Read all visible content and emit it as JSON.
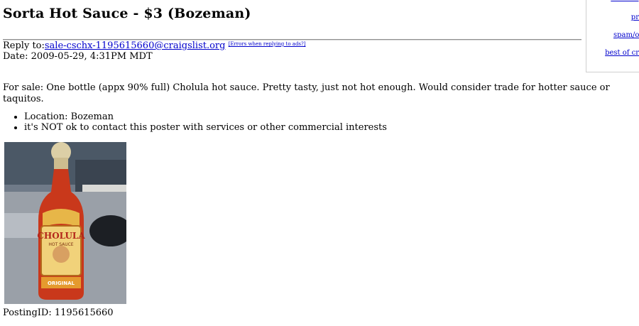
{
  "post": {
    "title": "Sorta Hot Sauce - $3 (Bozeman)",
    "reply_prefix": "Reply to:",
    "reply_email": "sale-cschx-1195615660@craigslist.org",
    "errors_link": "[Errors when replying to ads?]",
    "date_line": "Date: 2009-05-29, 4:31PM MDT",
    "body": "For sale: One bottle (appx 90% full) Cholula hot sauce. Pretty tasty, just not hot enough. Would consider trade for hotter sauce or taquitos.",
    "location": "Location: Bozeman",
    "contact_notice": "it's NOT ok to contact this poster with services or other commercial interests",
    "posting_id": "PostingID: 1195615660",
    "photo": {
      "brand_text": "CHOLULA",
      "sub_text": "HOT SAUCE",
      "band_text": "ORIGINAL"
    }
  },
  "sidebar": {
    "links": [
      "miscateg",
      "pro",
      "spam/ov",
      "best of cra"
    ]
  },
  "colors": {
    "link": "#0000cc",
    "divider": "#8f8f8f"
  }
}
